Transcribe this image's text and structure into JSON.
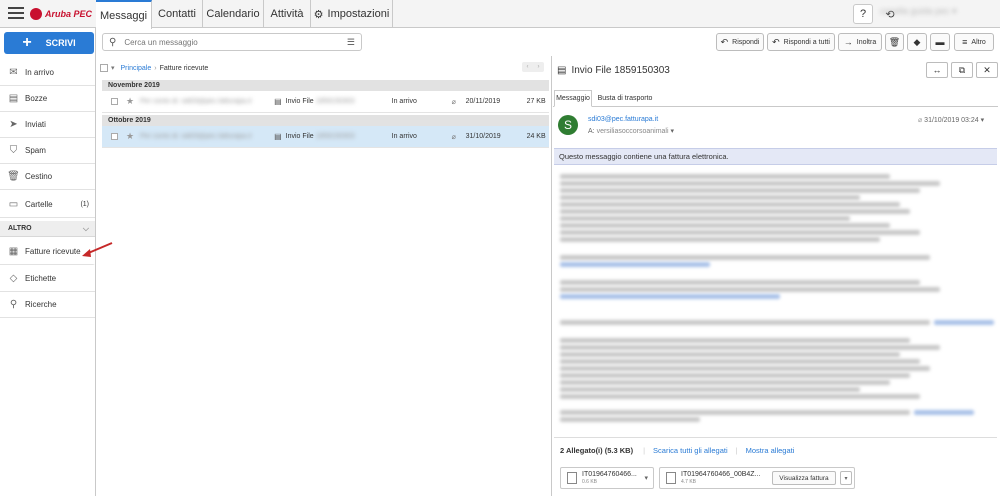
{
  "header": {
    "logo_text": "Aruba PEC",
    "tabs": [
      "Messaggi",
      "Contatti",
      "Calendario",
      "Attività",
      "Impostazioni"
    ],
    "active_tab": "Messaggi",
    "user_label": "casella guida pec"
  },
  "sidebar": {
    "compose_label": "SCRIVI",
    "items": [
      {
        "label": "In arrivo",
        "icon": "inbox-icon"
      },
      {
        "label": "Bozze",
        "icon": "drafts-icon"
      },
      {
        "label": "Inviati",
        "icon": "send-icon"
      },
      {
        "label": "Spam",
        "icon": "shield-icon"
      },
      {
        "label": "Cestino",
        "icon": "trash-icon"
      },
      {
        "label": "Cartelle",
        "icon": "folder-icon",
        "count": "(1)"
      }
    ],
    "section_title": "ALTRO",
    "section_items": [
      {
        "label": "Fatture ricevute",
        "icon": "invoice-icon"
      },
      {
        "label": "Etichette",
        "icon": "tag-icon"
      },
      {
        "label": "Ricerche",
        "icon": "search-icon"
      }
    ]
  },
  "search": {
    "placeholder": "Cerca un messaggio"
  },
  "toolbar": {
    "reply": "Rispondi",
    "reply_all": "Rispondi a tutti",
    "forward": "Inoltra",
    "more": "Altro"
  },
  "list": {
    "breadcrumb_root": "Principale",
    "breadcrumb_current": "Fatture ricevute",
    "groups": [
      {
        "title": "Novembre 2019",
        "rows": [
          {
            "from": "Per conto di: sdi03@pec.fatturapa.it",
            "subject": "Invio File",
            "subject_hidden": "1859150303",
            "folder": "In arrivo",
            "date": "20/11/2019",
            "size": "27 KB",
            "selected": false
          }
        ]
      },
      {
        "title": "Ottobre 2019",
        "rows": [
          {
            "from": "Per conto di: sdi03@pec.fatturapa.it",
            "subject": "Invio File",
            "subject_hidden": "1859150303",
            "folder": "In arrivo",
            "date": "31/10/2019",
            "size": "24 KB",
            "selected": true
          }
        ]
      }
    ]
  },
  "preview": {
    "title": "Invio File 1859150303",
    "tabs": [
      "Messaggio",
      "Busta di trasporto"
    ],
    "avatar_letter": "S",
    "sender": "sdi03@pec.fatturapa.it",
    "recipient_prefix": "A:",
    "recipient": "versiliasoccorsoanimali",
    "date": "31/10/2019 03:24",
    "notice": "Questo messaggio contiene una fattura elettronica.",
    "attachments_summary": "2 Allegato(i) (5.3 KB)",
    "download_all": "Scarica tutti gli allegati",
    "show_attachments": "Mostra allegati",
    "attachments": [
      {
        "name": "IT01964760466...",
        "size": "0.6 KB"
      },
      {
        "name": "IT01964760466_00B4Z...",
        "size": "4.7 KB"
      }
    ],
    "view_invoice": "Visualizza fattura"
  }
}
